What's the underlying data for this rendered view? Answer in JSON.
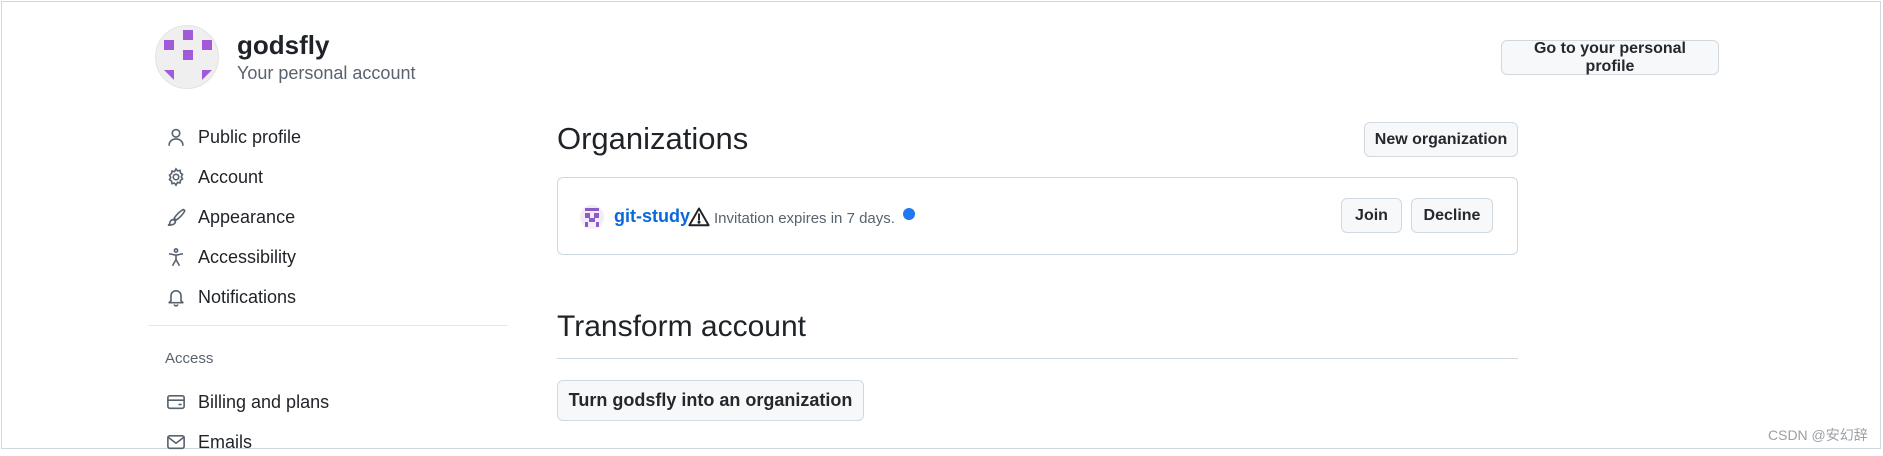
{
  "header": {
    "username": "godsfly",
    "subtitle": "Your personal account",
    "profile_button": "Go to your personal profile"
  },
  "sidebar": {
    "items": [
      {
        "label": "Public profile",
        "icon": "person-icon"
      },
      {
        "label": "Account",
        "icon": "gear-icon"
      },
      {
        "label": "Appearance",
        "icon": "paintbrush-icon"
      },
      {
        "label": "Accessibility",
        "icon": "accessibility-icon"
      },
      {
        "label": "Notifications",
        "icon": "bell-icon"
      }
    ],
    "access_heading": "Access",
    "access_items": [
      {
        "label": "Billing and plans",
        "icon": "credit-card-icon"
      },
      {
        "label": "Emails",
        "icon": "mail-icon"
      }
    ]
  },
  "organizations": {
    "title": "Organizations",
    "new_button": "New organization",
    "org": {
      "name": "git-study",
      "invite_text": "Invitation expires in 7 days.",
      "join_label": "Join",
      "decline_label": "Decline"
    }
  },
  "transform": {
    "title": "Transform account",
    "button": "Turn godsfly into an organization"
  },
  "watermark": "CSDN @安幻辞",
  "colors": {
    "link": "#0969da",
    "avatar": "#a25bd8",
    "dot": "#1f78f2"
  }
}
